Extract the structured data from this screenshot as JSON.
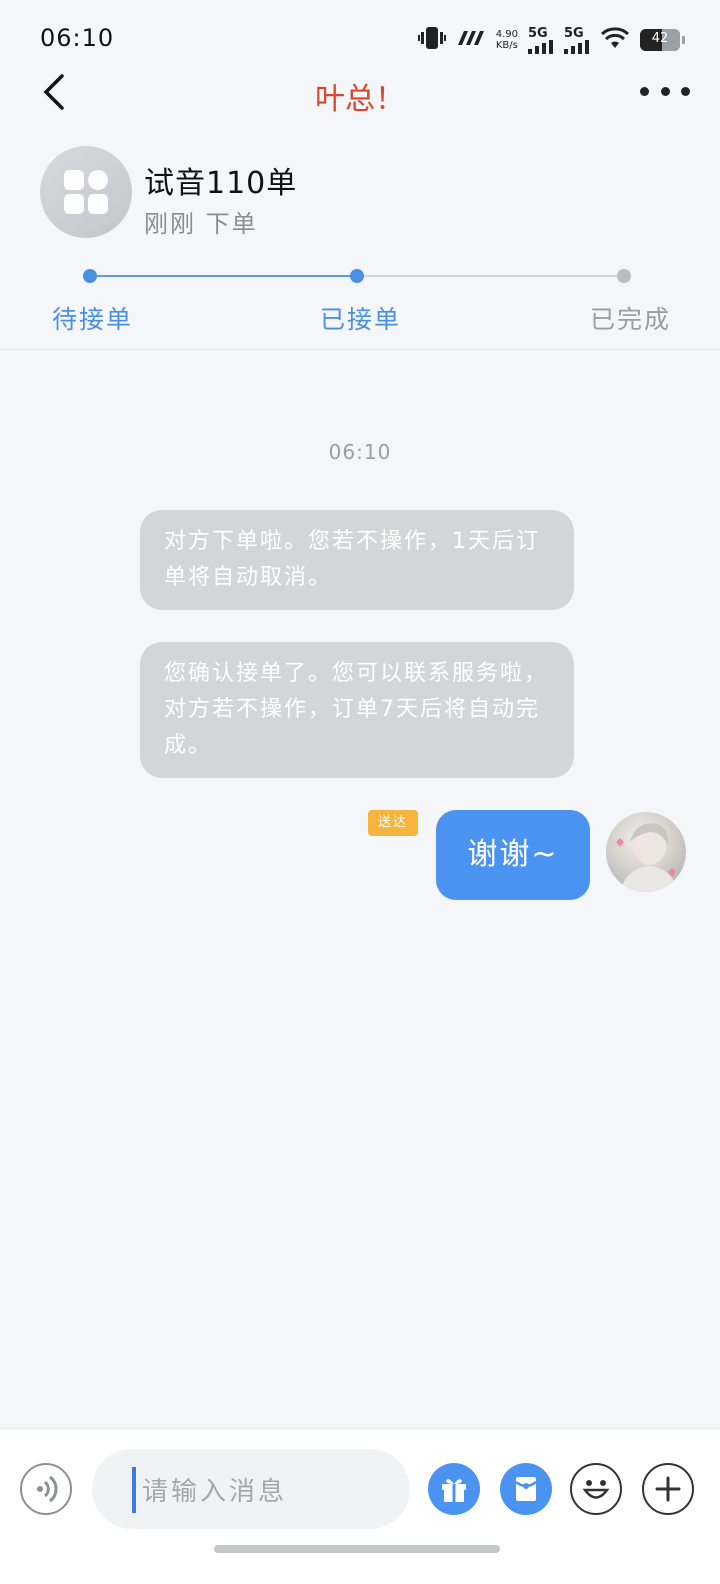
{
  "status_bar": {
    "time": "06:10",
    "net_speed_value": "4.90",
    "net_speed_unit": "KB/s",
    "signal1": "5G",
    "signal2": "5G",
    "battery": "42"
  },
  "nav": {
    "title": "叶总！"
  },
  "order": {
    "title": "试音110单",
    "subtitle": "刚刚 下单"
  },
  "progress": {
    "steps": [
      {
        "label": "待接单",
        "state": "done"
      },
      {
        "label": "已接单",
        "state": "current"
      },
      {
        "label": "已完成",
        "state": "pending"
      }
    ],
    "active_color": "#4a90e2",
    "inactive_color": "#b9bdc3"
  },
  "chat": {
    "time": "06:10",
    "system_messages": [
      "对方下单啦。您若不操作，1天后订单将自动取消。",
      "您确认接单了。您可以联系服务啦，对方若不操作，订单7天后将自动完成。"
    ],
    "my_message": {
      "status": "送达",
      "text": "谢谢~"
    }
  },
  "input_bar": {
    "placeholder": "请输入消息",
    "icons": [
      "voice-icon",
      "gift-icon",
      "red-packet-icon",
      "emoji-icon",
      "plus-icon"
    ],
    "accent": "#4b93f0"
  }
}
